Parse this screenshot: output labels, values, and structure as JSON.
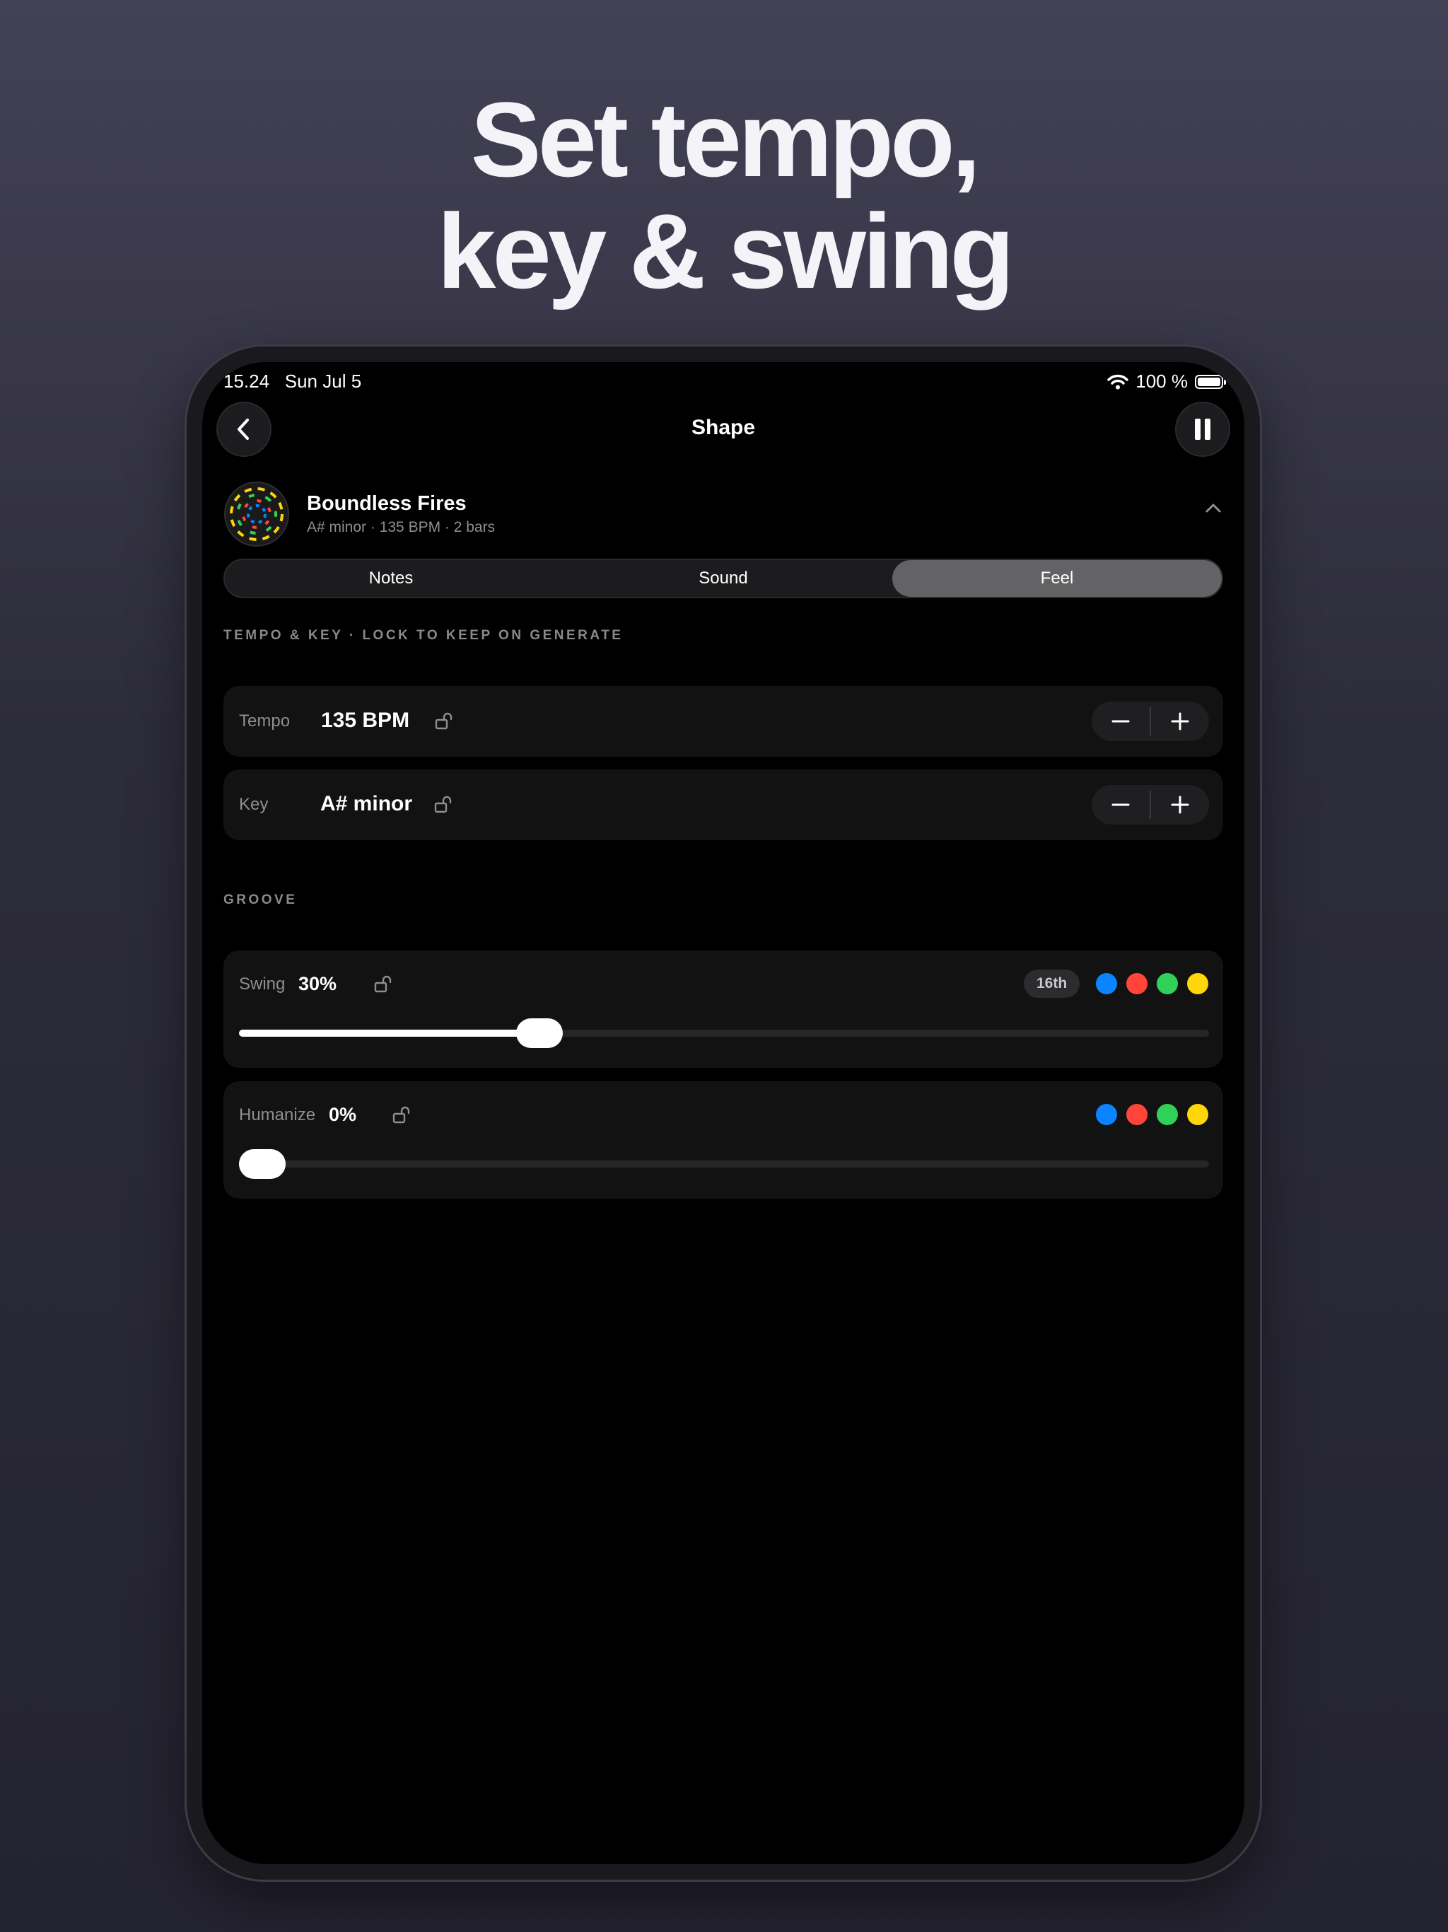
{
  "headline": {
    "line1": "Set tempo,",
    "line2": "key & swing"
  },
  "status_bar": {
    "time": "15.24",
    "date": "Sun Jul 5",
    "battery": "100 %"
  },
  "nav": {
    "title": "Shape"
  },
  "track": {
    "name": "Boundless Fires",
    "meta": "A# minor · 135 BPM · 2 bars"
  },
  "tabs": [
    {
      "label": "Notes",
      "active": false
    },
    {
      "label": "Sound",
      "active": false
    },
    {
      "label": "Feel",
      "active": true
    }
  ],
  "tempo_key_section": {
    "label": "TEMPO & KEY · LOCK TO KEEP ON GENERATE",
    "tempo": {
      "label": "Tempo",
      "value": "135 BPM",
      "minus": "−",
      "plus": "+"
    },
    "key": {
      "label": "Key",
      "value": "A# minor",
      "minus": "−",
      "plus": "+"
    }
  },
  "groove_section": {
    "label": "GROOVE",
    "swing": {
      "label": "Swing",
      "value": "30%",
      "level": 0.3,
      "division": "16th"
    },
    "humanize": {
      "label": "Humanize",
      "value": "0%",
      "level": 0.0
    }
  },
  "colors": {
    "accent_blue": "#0a84ff",
    "accent_red": "#ff453a",
    "accent_green": "#30d158",
    "accent_yellow": "#ffd60a",
    "screen_bg": "#000000",
    "card_bg": "#121213"
  },
  "icons": {
    "back": "chevron-left-icon",
    "pause": "pause-icon",
    "collapse": "chevron-up-icon",
    "lock": "unlocked-padlock-icon",
    "wifi": "wifi-icon",
    "battery": "battery-icon"
  }
}
